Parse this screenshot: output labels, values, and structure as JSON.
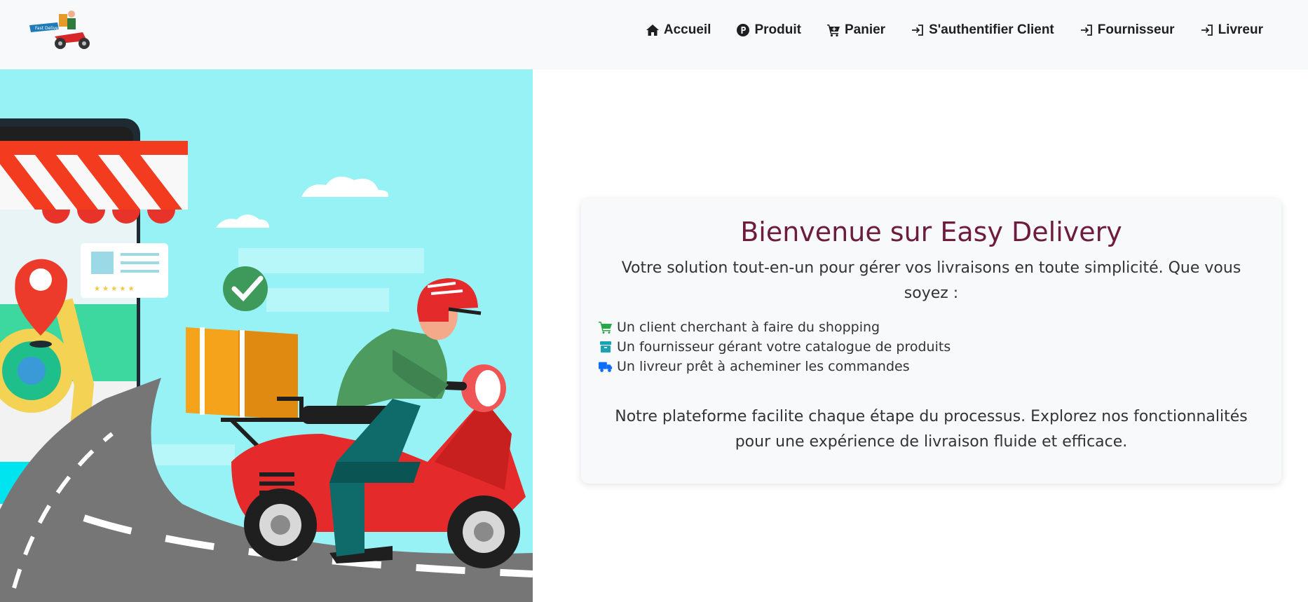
{
  "nav": {
    "brand_icon": "delivery-scooter-logo",
    "items": [
      {
        "label": "Accueil",
        "icon": "home-icon"
      },
      {
        "label": "Produit",
        "icon": "p-circle-icon"
      },
      {
        "label": "Panier",
        "icon": "cart-icon"
      },
      {
        "label": "S'authentifier Client",
        "icon": "login-icon"
      },
      {
        "label": "Fournisseur",
        "icon": "login-icon"
      },
      {
        "label": "Livreur",
        "icon": "login-icon"
      }
    ]
  },
  "hero": {
    "image": "delivery-scooter-illustration"
  },
  "welcome": {
    "title": "Bienvenue sur Easy Delivery",
    "intro": "Votre solution tout-en-un pour gérer vos livraisons en toute simplicité. Que vous soyez :",
    "roles": [
      {
        "text": "Un client cherchant à faire du shopping",
        "icon": "cart-icon",
        "color": "#28a745"
      },
      {
        "text": "Un fournisseur gérant votre catalogue de produits",
        "icon": "box-icon",
        "color": "#17a2b8"
      },
      {
        "text": "Un livreur prêt à acheminer les commandes",
        "icon": "truck-icon",
        "color": "#0d6efd"
      }
    ],
    "outro": "Notre plateforme facilite chaque étape du processus. Explorez nos fonctionnalités pour une expérience de livraison fluide et efficace."
  },
  "colors": {
    "navbar_bg": "#f8f9fa",
    "title": "#6d1c3e",
    "hero_sky": "#97f2f6"
  }
}
